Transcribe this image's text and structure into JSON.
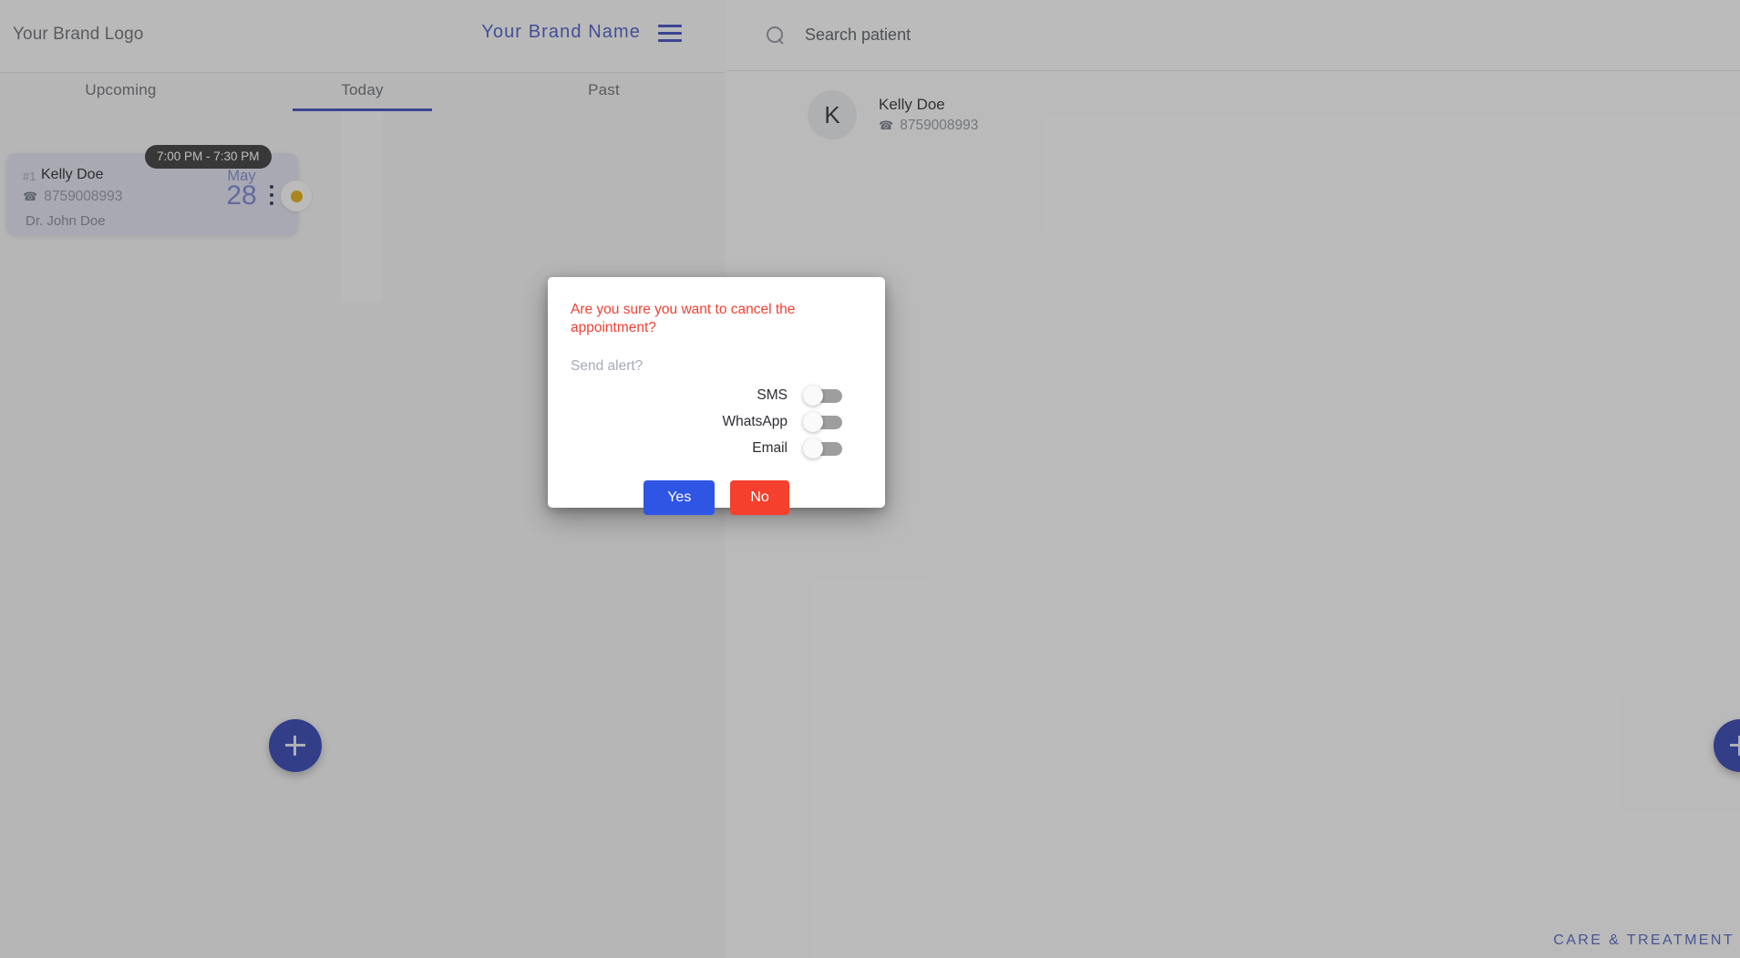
{
  "left_panel": {
    "header": {
      "logo_text": "Your Brand Logo",
      "brand_name": "Your Brand Name",
      "menu_icon": "hamburger-menu-icon"
    },
    "tabs": [
      {
        "label": "Upcoming",
        "active": false
      },
      {
        "label": "Today",
        "active": true
      },
      {
        "label": "Past",
        "active": false
      }
    ],
    "appointments": [
      {
        "time_range": "7:00 PM - 7:30 PM",
        "rank": "#1",
        "patient_name": "Kelly Doe",
        "phone": "8759008993",
        "phone_icon": "phone-icon",
        "doctor": "Dr. John Doe",
        "month": "May",
        "day": "28",
        "menu_icon": "kebab-menu-icon",
        "status_color": "#e3a600"
      }
    ],
    "add_button_icon": "plus-icon"
  },
  "right_panel": {
    "search": {
      "icon": "search-icon",
      "placeholder": "Search patient",
      "value": ""
    },
    "patients": [
      {
        "initial": "K",
        "name": "Kelly Doe",
        "phone": "8759008993",
        "phone_icon": "phone-icon"
      }
    ],
    "add_button_icon": "plus-icon"
  },
  "footer": {
    "brand_text": "CARE & TREATMENT"
  },
  "modal": {
    "title": "Are you sure you want to cancel the appointment?",
    "subtitle": "Send alert?",
    "toggles": [
      {
        "label": "SMS",
        "state": "off"
      },
      {
        "label": "WhatsApp",
        "state": "off"
      },
      {
        "label": "Email",
        "state": "off"
      }
    ],
    "confirm_label": "Yes",
    "cancel_label": "No"
  },
  "colors": {
    "brand_blue": "#2f3fbb",
    "danger_red": "#ef4134",
    "confirm_blue": "#2f55e5",
    "cancel_red": "#f4402c",
    "status_amber": "#e3a600"
  }
}
